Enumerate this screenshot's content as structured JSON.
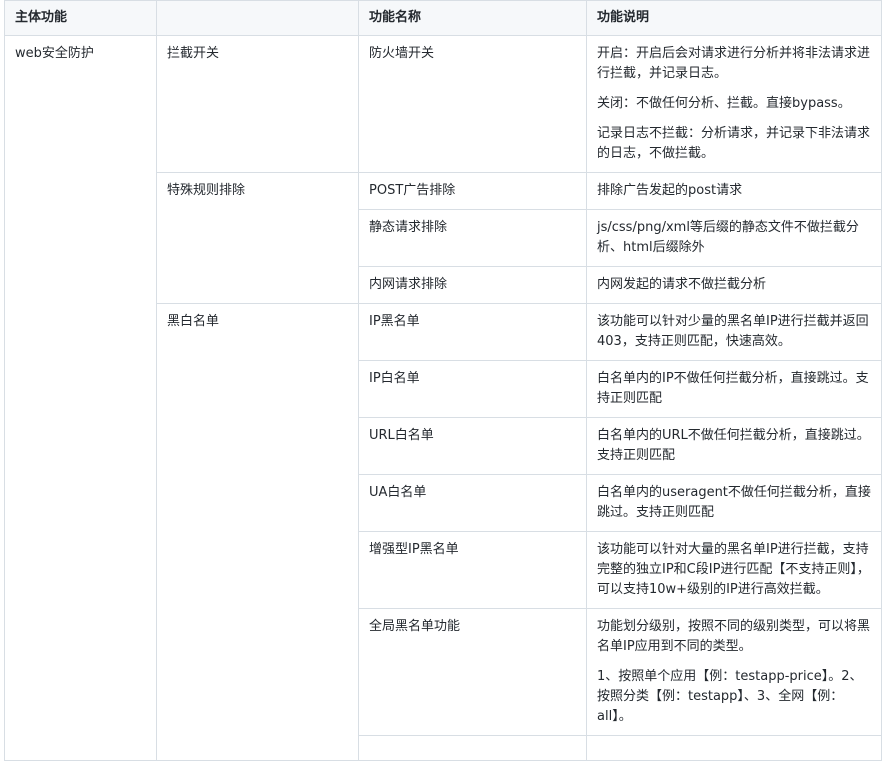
{
  "headers": [
    "主体功能",
    "",
    "功能名称",
    "功能说明"
  ],
  "main_feature": "web安全防护",
  "groups": [
    {
      "name": "拦截开关",
      "rows": [
        {
          "name": "防火墙开关",
          "desc": [
            "开启：开启后会对请求进行分析并将非法请求进行拦截，并记录日志。",
            "关闭：不做任何分析、拦截。直接bypass。",
            "记录日志不拦截：分析请求，并记录下非法请求的日志，不做拦截。"
          ]
        }
      ]
    },
    {
      "name": "特殊规则排除",
      "rows": [
        {
          "name": "POST广告排除",
          "desc": [
            "排除广告发起的post请求"
          ]
        },
        {
          "name": "静态请求排除",
          "desc": [
            "js/css/png/xml等后缀的静态文件不做拦截分析、html后缀除外"
          ]
        },
        {
          "name": "内网请求排除",
          "desc": [
            "内网发起的请求不做拦截分析"
          ]
        }
      ]
    },
    {
      "name": "黑白名单",
      "rows": [
        {
          "name": "IP黑名单",
          "desc": [
            "该功能可以针对少量的黑名单IP进行拦截并返回403，支持正则匹配，快速高效。"
          ]
        },
        {
          "name": "IP白名单",
          "desc": [
            "白名单内的IP不做任何拦截分析，直接跳过。支持正则匹配"
          ]
        },
        {
          "name": "URL白名单",
          "desc": [
            "白名单内的URL不做任何拦截分析，直接跳过。支持正则匹配"
          ]
        },
        {
          "name": "UA白名单",
          "desc": [
            "白名单内的useragent不做任何拦截分析，直接跳过。支持正则匹配"
          ]
        },
        {
          "name": "增强型IP黑名单",
          "desc": [
            "该功能可以针对大量的黑名单IP进行拦截，支持完整的独立IP和C段IP进行匹配【不支持正则】，可以支持10w+级别的IP进行高效拦截。"
          ]
        },
        {
          "name": "全局黑名单功能",
          "desc": [
            "功能划分级别，按照不同的级别类型，可以将黑名单IP应用到不同的类型。",
            "1、按照单个应用【例：testapp-price】。2、按照分类【例：testapp】、3、全网【例：all】。"
          ]
        }
      ]
    }
  ]
}
